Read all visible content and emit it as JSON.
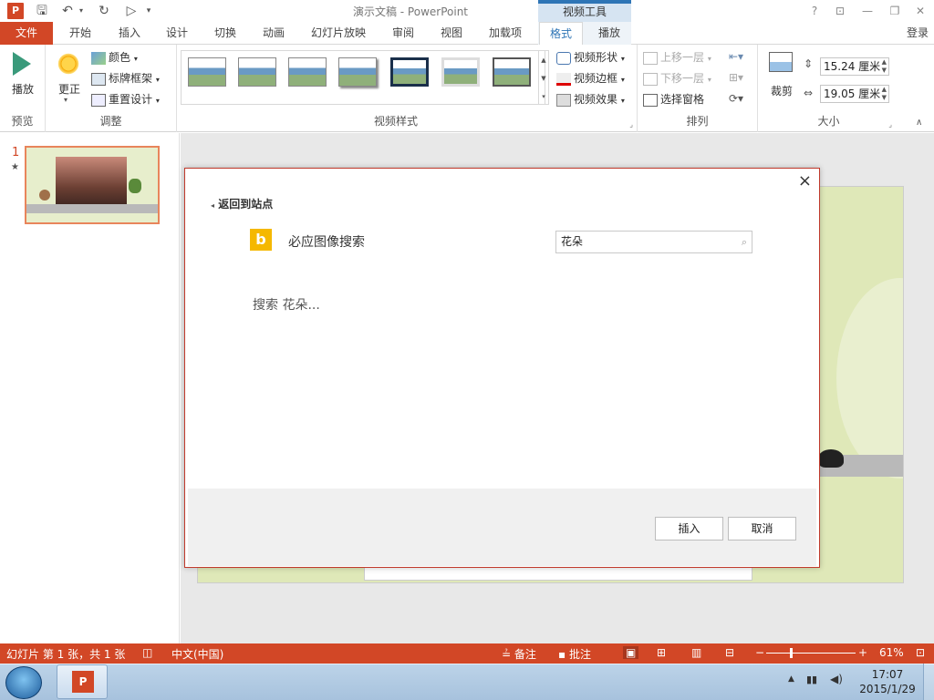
{
  "window": {
    "title": "演示文稿 - PowerPoint",
    "context_tools": "视频工具",
    "help": "?",
    "login": "登录"
  },
  "tabs": {
    "file": "文件",
    "items": [
      "开始",
      "插入",
      "设计",
      "切换",
      "动画",
      "幻灯片放映",
      "审阅",
      "视图",
      "加载项"
    ],
    "format": "格式",
    "playback": "播放"
  },
  "ribbon": {
    "preview": {
      "play": "播放",
      "group": "预览"
    },
    "adjust": {
      "correct": "更正",
      "color": "颜色",
      "poster_frame": "标牌框架",
      "reset_design": "重置设计",
      "group": "调整"
    },
    "video_styles": {
      "group": "视频样式",
      "shape": "视频形状",
      "border": "视频边框",
      "effects": "视频效果"
    },
    "arrange": {
      "bring_forward": "上移一层",
      "send_backward": "下移一层",
      "selection_pane": "选择窗格",
      "group": "排列"
    },
    "size": {
      "crop": "裁剪",
      "height": "15.24 厘米",
      "width": "19.05 厘米",
      "group": "大小"
    }
  },
  "slides_pane": {
    "number": "1",
    "star": "★"
  },
  "dialog": {
    "back_link": "返回到站点",
    "source": "必应图像搜索",
    "search_value": "花朵",
    "status": "搜索 花朵...",
    "insert": "插入",
    "cancel": "取消",
    "close": "×"
  },
  "status_bar": {
    "slide_info": "幻灯片 第 1 张，共 1 张",
    "language": "中文(中国)",
    "notes": "备注",
    "comments": "批注",
    "zoom": "61%"
  },
  "taskbar": {
    "time": "17:07",
    "date": "2015/1/29"
  },
  "colors": {
    "accent": "#d24726",
    "context": "#2e75b6",
    "bing": "#f5b800"
  }
}
